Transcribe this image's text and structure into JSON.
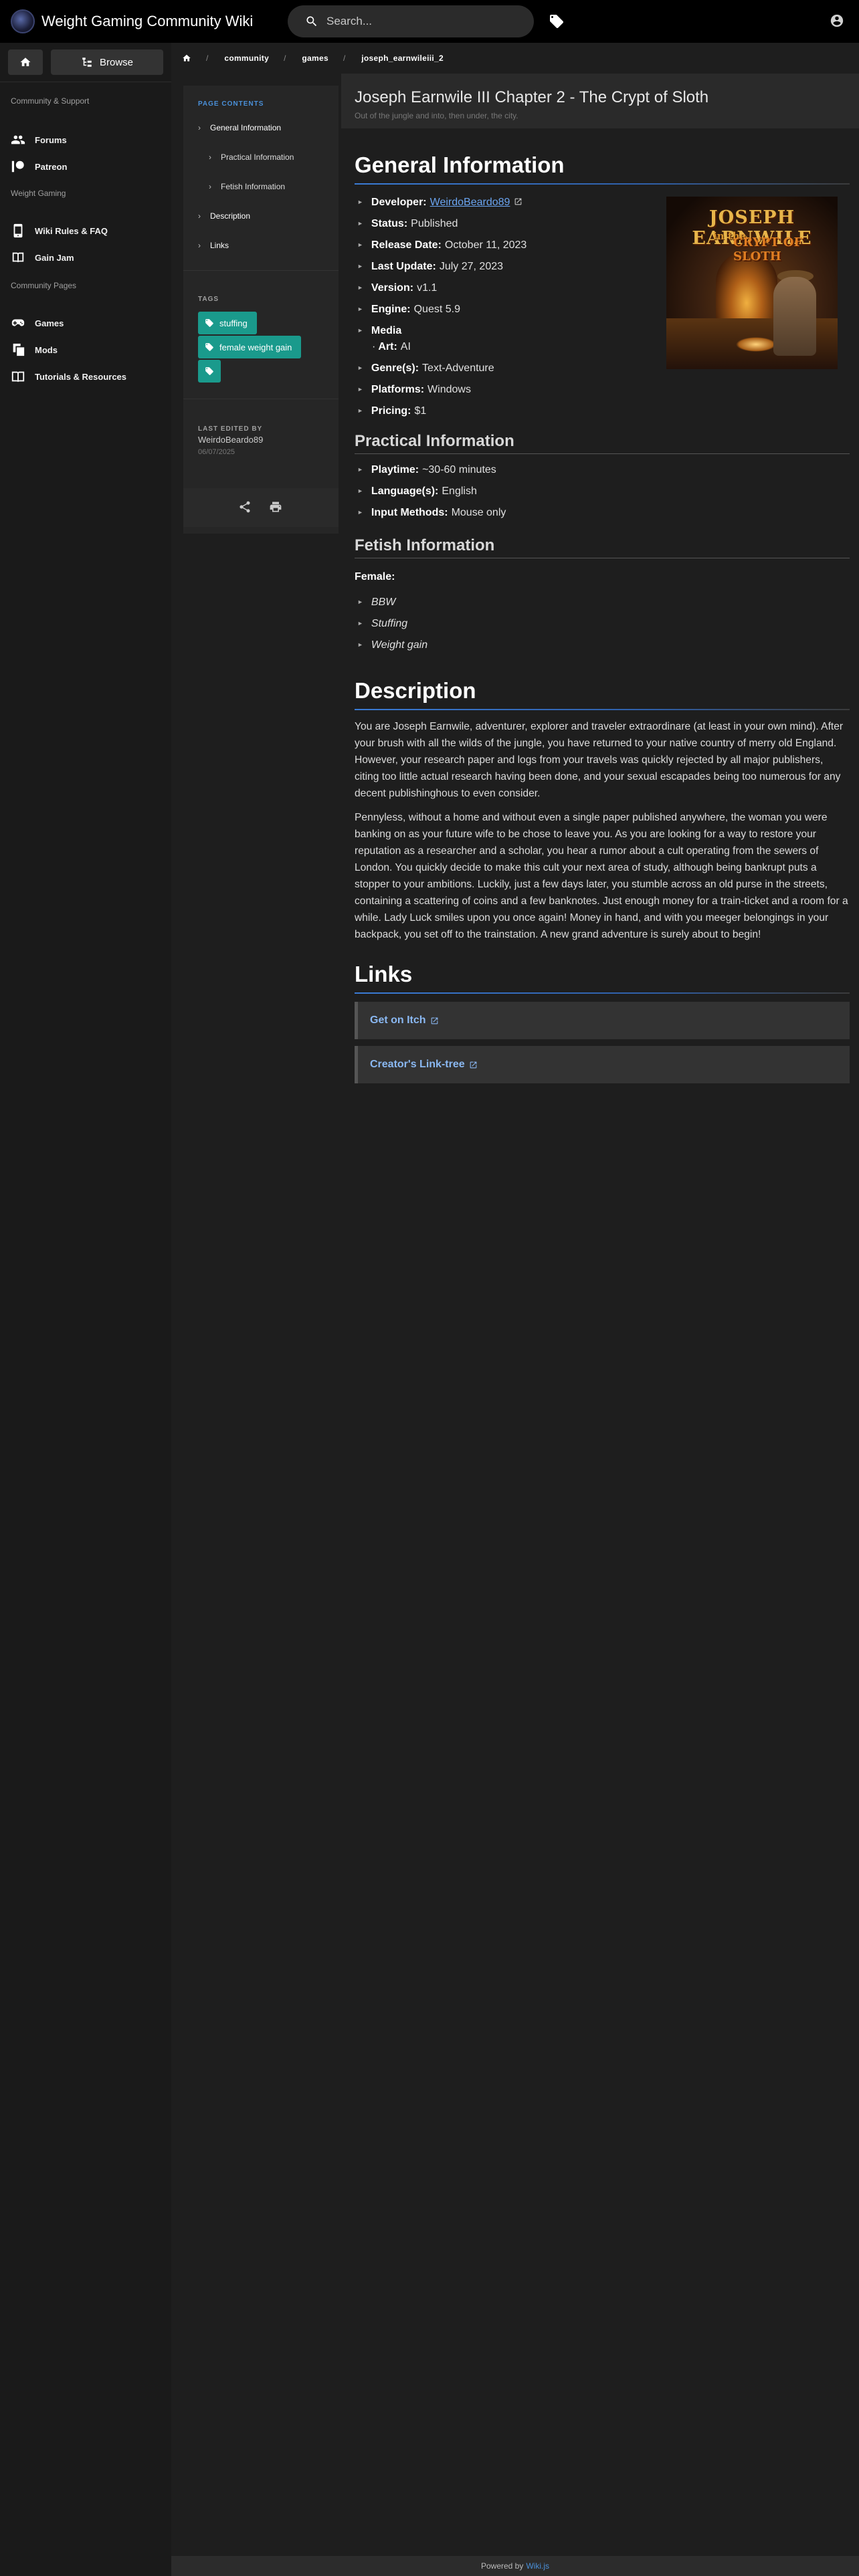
{
  "app": {
    "title": "Weight Gaming Community Wiki",
    "search_placeholder": "Search..."
  },
  "nav": {
    "browse_label": "Browse",
    "community_header": "Community & Support",
    "weight_gaming_header": "Weight Gaming",
    "community_pages_header": "Community Pages",
    "items": [
      {
        "label": "Forums",
        "icon": "users-icon"
      },
      {
        "label": "Patreon",
        "icon": "patreon-icon"
      },
      {
        "label": "Wiki Rules & FAQ",
        "icon": "phone-icon"
      },
      {
        "label": "Gain Jam",
        "icon": "book-icon"
      },
      {
        "label": "Games",
        "icon": "gamepad-icon"
      },
      {
        "label": "Mods",
        "icon": "layers-icon"
      },
      {
        "label": "Tutorials & Resources",
        "icon": "book-open-icon"
      }
    ]
  },
  "breadcrumbs": [
    "community",
    "games",
    "joseph_earnwileiii_2"
  ],
  "toc": {
    "label": "PAGE CONTENTS",
    "items": [
      {
        "label": "General Information"
      },
      {
        "label": "Practical Information"
      },
      {
        "label": "Fetish Information"
      },
      {
        "label": "Description"
      },
      {
        "label": "Links"
      }
    ],
    "tags_label": "TAGS",
    "tags": [
      "stuffing",
      "female weight gain",
      ""
    ],
    "last_edited_label": "LAST EDITED BY",
    "last_edited_user": "WeirdoBeardo89",
    "last_edited_date": "06/07/2025"
  },
  "page": {
    "title": "Joseph Earnwile III Chapter 2 - The Crypt of Sloth",
    "subtitle": "Out of the jungle and into, then under, the city."
  },
  "general": {
    "heading": "General Information",
    "developer_label": "Developer:",
    "developer": "WeirdoBeardo89",
    "status_label": "Status:",
    "status": "Published",
    "release_label": "Release Date:",
    "release": "October 11, 2023",
    "update_label": "Last Update:",
    "update": "July 27, 2023",
    "version_label": "Version:",
    "version": "v1.1",
    "engine_label": "Engine:",
    "engine": "Quest 5.9",
    "media_label": "Media",
    "art_label": "Art:",
    "art": "AI",
    "genre_label": "Genre(s):",
    "genre": "Text-Adventure",
    "platforms_label": "Platforms:",
    "platforms": "Windows",
    "pricing_label": "Pricing:",
    "pricing": "$1"
  },
  "cover": {
    "line1": "JOSEPH EARNWILE",
    "line2": "in the",
    "line3": "CRYPT OF SLOTH"
  },
  "practical": {
    "heading": "Practical Information",
    "playtime_label": "Playtime:",
    "playtime": "~30-60 minutes",
    "language_label": "Language(s):",
    "language": "English",
    "input_label": "Input Methods:",
    "input": "Mouse only"
  },
  "fetish": {
    "heading": "Fetish Information",
    "female_label": "Female:",
    "items": [
      "BBW",
      "Stuffing",
      "Weight gain"
    ]
  },
  "description": {
    "heading": "Description",
    "para1": "You are Joseph Earnwile, adventurer, explorer and traveler extraordinare (at least in your own mind). After your brush with all the wilds of the jungle, you have returned to your native country of merry old England. However, your research paper and logs from your travels was quickly rejected by all major publishers, citing too little actual research having been done, and your sexual escapades being too numerous for any decent publishinghous to even consider.",
    "para2": "Pennyless, without a home and without even a single paper published anywhere, the woman you were banking on as your future wife to be chose to leave you. As you are looking for a way to restore your reputation as a researcher and a scholar, you hear a rumor about a cult operating from the sewers of London. You quickly decide to make this cult your next area of study, although being bankrupt puts a stopper to your ambitions. Luckily, just a few days later, you stumble across an old purse in the streets, containing a scattering of coins and a few banknotes. Just enough money for a train-ticket and a room for a while. Lady Luck smiles upon you once again! Money in hand, and with you meeger belongings in your backpack, you set off to the trainstation. A new grand adventure is surely about to begin!"
  },
  "links": {
    "heading": "Links",
    "items": [
      {
        "label": "Get on Itch"
      },
      {
        "label": "Creator's Link-tree"
      }
    ]
  },
  "footer": {
    "powered_by": "Powered by",
    "wikijs": "Wiki.js"
  }
}
